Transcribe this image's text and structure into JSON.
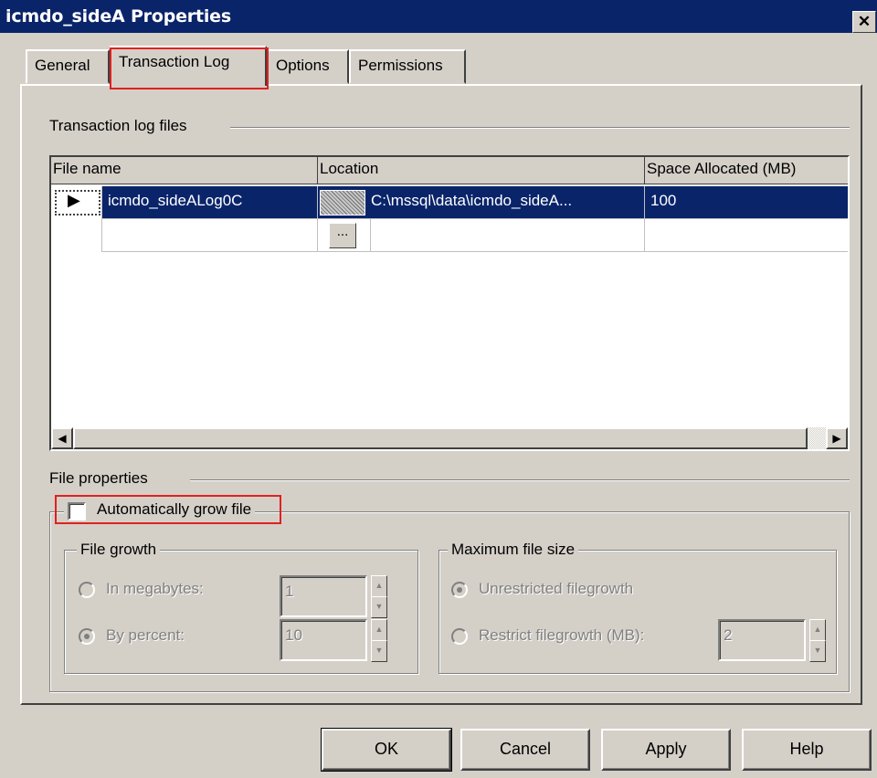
{
  "window": {
    "title": "icmdo_sideA Properties",
    "close_glyph": "✕"
  },
  "tabs": [
    {
      "label": "General"
    },
    {
      "label": "Transaction Log",
      "selected": true
    },
    {
      "label": "Options"
    },
    {
      "label": "Permissions"
    }
  ],
  "log_files_group": {
    "label": "Transaction log files"
  },
  "grid": {
    "columns": [
      "File name",
      "Location",
      "Space Allocated (MB)"
    ],
    "rows": [
      {
        "file_name": "icmdo_sideALog0C",
        "location": "C:\\mssql\\data\\icmdo_sideA...",
        "space_mb": "100",
        "selected": true
      },
      {
        "file_name": "",
        "location": "",
        "space_mb": ""
      }
    ],
    "ellipsis": "...",
    "scroll_left": "◀",
    "scroll_right": "▶",
    "row_pointer": "▶"
  },
  "file_properties": {
    "label": "File properties",
    "auto_grow_label": "Automatically grow file",
    "auto_grow_checked": false
  },
  "file_growth": {
    "label": "File growth",
    "in_megabytes_label": "In megabytes:",
    "in_megabytes_value": "1",
    "by_percent_label": "By percent:",
    "by_percent_value": "10",
    "selected": "by_percent"
  },
  "max_file_size": {
    "label": "Maximum file size",
    "unrestricted_label": "Unrestricted filegrowth",
    "restrict_label": "Restrict filegrowth (MB):",
    "restrict_value": "2",
    "selected": "unrestricted"
  },
  "spin_up": "▲",
  "spin_down": "▼",
  "buttons": {
    "ok": "OK",
    "cancel": "Cancel",
    "apply": "Apply",
    "help": "Help"
  },
  "colors": {
    "titlebar": "#0a246a",
    "face": "#d4d0c8",
    "selection": "#0a246a",
    "highlight_box": "#e02020"
  }
}
